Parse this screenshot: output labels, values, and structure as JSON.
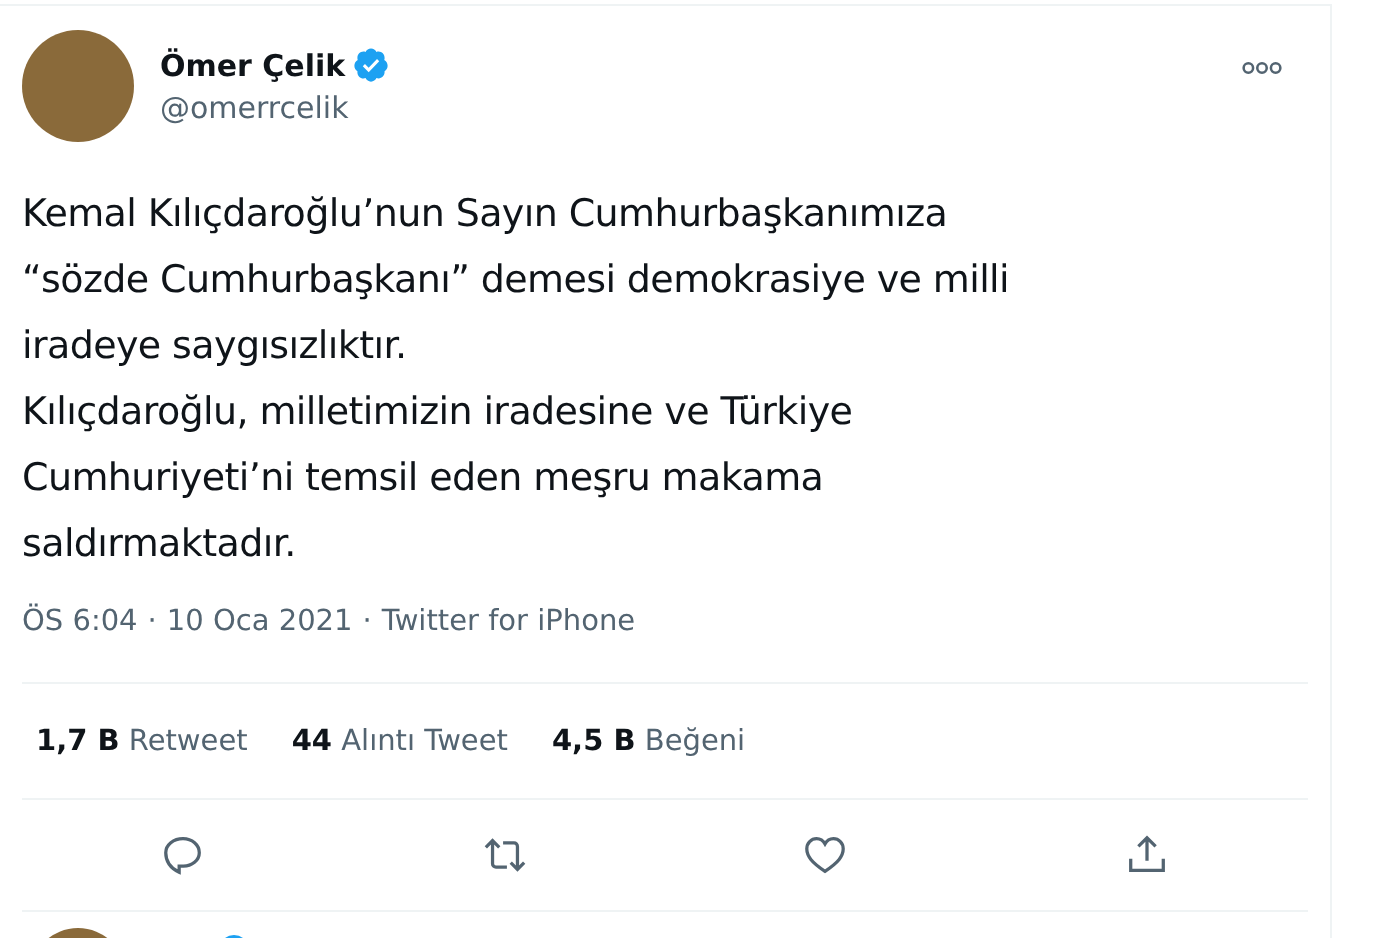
{
  "tweet": {
    "author": {
      "name": "Ömer Çelik",
      "verified": true,
      "handle": "@omerrcelik"
    },
    "text_lines": [
      "Kemal Kılıçdaroğlu’nun Sayın Cumhurbaşkanımıza",
      "“sözde Cumhurbaşkanı” demesi demokrasiye ve milli",
      "iradeye saygısızlıktır.",
      "Kılıçdaroğlu, milletimizin iradesine ve Türkiye",
      "Cumhuriyeti’ni temsil eden meşru makama",
      "saldırmaktadır."
    ],
    "meta": [
      "ÖS 6:04",
      "·",
      "10 Oca 2021",
      "·",
      "Twitter for iPhone"
    ],
    "stats": [
      {
        "count": "1,7 B",
        "label": "Retweet"
      },
      {
        "count": "44",
        "label": "Alıntı Tweet"
      },
      {
        "count": "4,5 B",
        "label": "Beğeni"
      }
    ],
    "actions": [
      {
        "kind": "reply"
      },
      {
        "kind": "retweet"
      },
      {
        "kind": "like"
      },
      {
        "kind": "share"
      }
    ]
  },
  "next_tweet": {
    "verified": true
  }
}
